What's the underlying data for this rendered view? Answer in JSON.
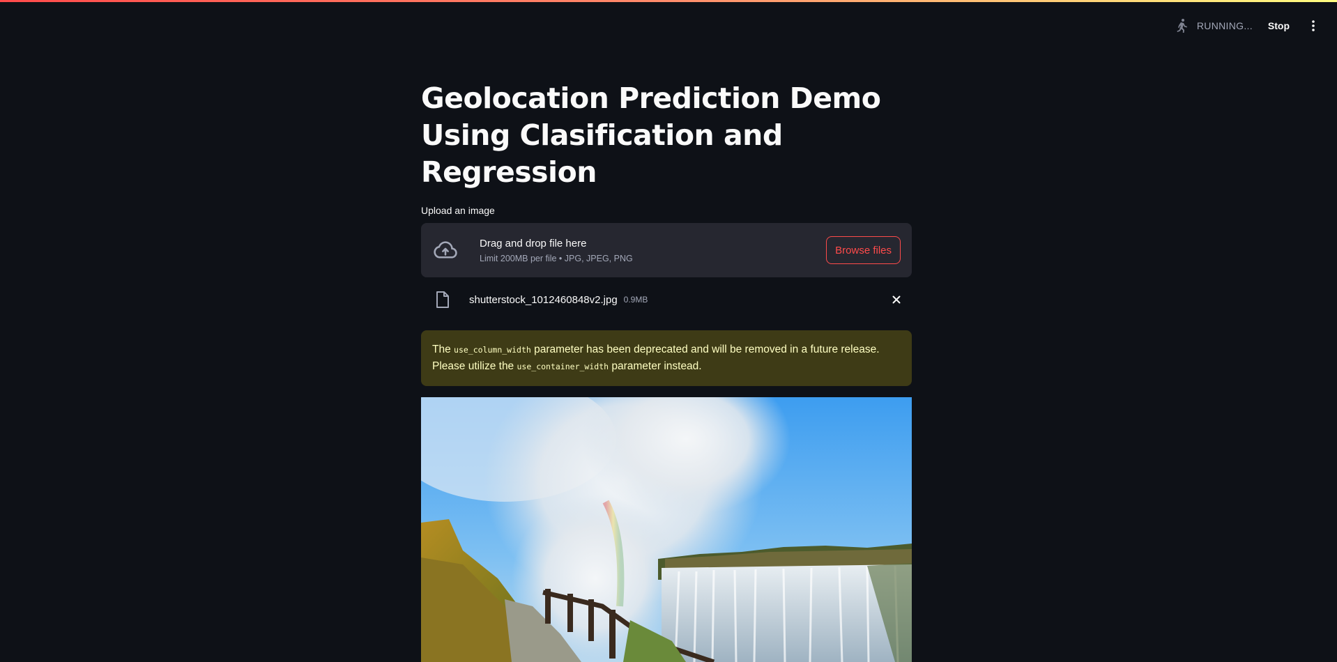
{
  "app": {
    "status_text": "RUNNING...",
    "stop_label": "Stop",
    "accent_color": "#ff4b4b"
  },
  "main": {
    "title": "Geolocation Prediction Demo Using Clasification and Regression",
    "uploader": {
      "label": "Upload an image",
      "drop_text": "Drag and drop file here",
      "limit_text": "Limit 200MB per file • JPG, JPEG, PNG",
      "browse_label": "Browse files"
    },
    "uploaded_file": {
      "name": "shutterstock_1012460848v2.jpg",
      "size": "0.9MB"
    },
    "warning": {
      "pre": "The ",
      "code1": "use_column_width",
      "mid": " parameter has been deprecated and will be removed in a future release. Please utilize the ",
      "code2": "use_container_width",
      "post": " parameter instead."
    },
    "image": {
      "icon": "waterfall-photo"
    }
  }
}
